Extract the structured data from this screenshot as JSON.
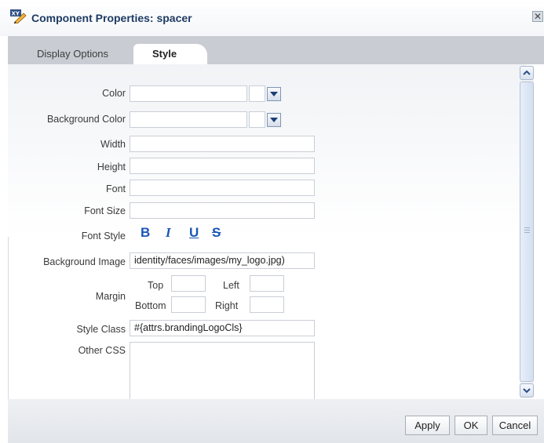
{
  "dialog": {
    "title": "Component Properties: spacer",
    "close_glyph": "✕"
  },
  "tabs": [
    {
      "label": "Display Options",
      "selected": false
    },
    {
      "label": "Style",
      "selected": true
    }
  ],
  "form": {
    "color": {
      "label": "Color",
      "value": ""
    },
    "background_color": {
      "label": "Background Color",
      "value": ""
    },
    "width": {
      "label": "Width",
      "value": ""
    },
    "height": {
      "label": "Height",
      "value": ""
    },
    "font": {
      "label": "Font",
      "value": ""
    },
    "font_size": {
      "label": "Font Size",
      "value": ""
    },
    "font_style": {
      "label": "Font Style",
      "bold": "B",
      "italic": "I",
      "underline": "U",
      "strikethrough": "S"
    },
    "background_image": {
      "label": "Background Image",
      "value": "identity/faces/images/my_logo.jpg)"
    },
    "margin": {
      "label": "Margin",
      "top_label": "Top",
      "left_label": "Left",
      "bottom_label": "Bottom",
      "right_label": "Right"
    },
    "style_class": {
      "label": "Style Class",
      "value": "#{attrs.brandingLogoCls}"
    },
    "other_css": {
      "label": "Other CSS",
      "value": ""
    }
  },
  "buttons": {
    "apply": "Apply",
    "ok": "OK",
    "cancel": "Cancel"
  },
  "colors": {
    "title": "#1f3b64",
    "font_style_icons": "#1a57b4",
    "tab_strip": "#c9cdd3"
  }
}
